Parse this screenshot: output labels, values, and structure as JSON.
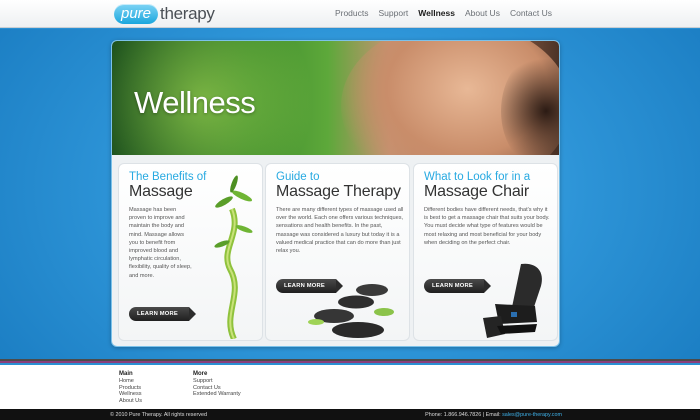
{
  "header": {
    "logo_pill": "pure",
    "logo_word": "therapy",
    "nav": [
      {
        "label": "Products"
      },
      {
        "label": "Support"
      },
      {
        "label": "Wellness"
      },
      {
        "label": "About Us"
      },
      {
        "label": "Contact Us"
      }
    ],
    "active_nav": "Wellness"
  },
  "hero": {
    "title": "Wellness"
  },
  "columns": [
    {
      "kicker": "The Benefits of",
      "heading": "Massage",
      "body": "Massage has been proven to improve and maintain the body and mind. Massage allows you to benefit from improved blood and lymphatic circulation, flexibility, quality of sleep, and more.",
      "button": "LEARN MORE",
      "art": "bamboo-plant"
    },
    {
      "kicker": "Guide to",
      "heading": "Massage Therapy",
      "body": "There are many different types of massage used all over the world. Each one offers various techniques, sensations and health benefits. In the past, massage was considered a luxury but today it is a valued medical practice that can do more than just relax you.",
      "button": "LEARN MORE",
      "art": "spa-stones"
    },
    {
      "kicker": "What to Look for in a",
      "heading": "Massage Chair",
      "body": "Different bodies have different needs, that's why it is best to get a massage chair that suits your body. You must decide what type of features would be most relaxing and most beneficial for your body when deciding on the perfect chair.",
      "button": "LEARN MORE",
      "art": "massage-chair"
    }
  ],
  "footer": {
    "main": {
      "heading": "Main",
      "links": [
        "Home",
        "Products",
        "Wellness",
        "About Us"
      ]
    },
    "more": {
      "heading": "More",
      "links": [
        "Support",
        "Contact Us",
        "Extended Warranty"
      ]
    },
    "copyright": "© 2010 Pure Therapy. All rights reserved",
    "phone": "Phone: 1.866.946.7826 | Email:",
    "email": "sales@pure-therapy.com"
  },
  "colors": {
    "accent": "#27a9e1",
    "background": "#2a90d3",
    "button": "#1f1f1f"
  }
}
